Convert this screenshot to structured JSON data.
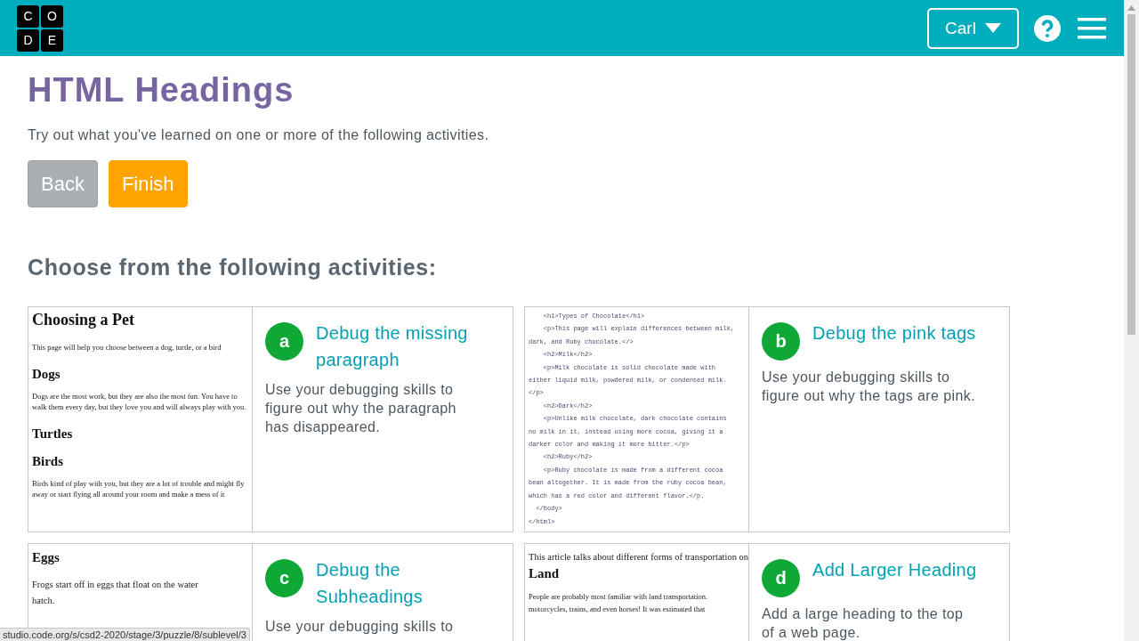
{
  "header": {
    "logo": [
      "C",
      "O",
      "D",
      "E"
    ],
    "user_button": "Carl"
  },
  "title": "HTML Headings",
  "intro": "Try out what you've learned on one or more of the following activities.",
  "buttons": [
    {
      "label": "Back",
      "disabled": true
    },
    {
      "label": "Finish",
      "disabled": false
    }
  ],
  "section_heading": "Choose from the following activities:",
  "activities": [
    {
      "letter": "a",
      "title": "Debug the missing paragraph",
      "description": "Use your debugging skills to figure out why the paragraph has disappeared.",
      "preview": [
        {
          "kind": "h1",
          "text": "Choosing a Pet"
        },
        {
          "kind": "p",
          "text": "This page will help you choose between a dog, turtle, or a bird"
        },
        {
          "kind": "h2",
          "text": "Dogs"
        },
        {
          "kind": "p",
          "text": "Dogs are the most work, but they are also the most fun. You have to walk them every day, but they love you and will always play with you."
        },
        {
          "kind": "h2",
          "text": "Turtles"
        },
        {
          "kind": "h2",
          "text": "Birds"
        },
        {
          "kind": "p",
          "text": "Birds kind of play with you, but they are a lot of trouble and might fly away or start flying all around your room and make a mess of it"
        }
      ]
    },
    {
      "letter": "b",
      "title": "Debug the pink tags",
      "description": "Use your debugging skills to figure out why the tags are pink.",
      "preview": [
        {
          "kind": "code",
          "text": "    <h1>Types of Chocolate</h1>"
        },
        {
          "kind": "code",
          "text": "    <p>This page will explain differences between milk,"
        },
        {
          "kind": "code",
          "text": "dark, and Ruby chocolate.</>"
        },
        {
          "kind": "code",
          "text": "    <h2>Milk</h2>"
        },
        {
          "kind": "code",
          "text": "    <p>Milk chocolate is solid chocolate made with"
        },
        {
          "kind": "code",
          "text": "either liquid milk, powdered milk, or condensed milk."
        },
        {
          "kind": "code",
          "text": "</p>"
        },
        {
          "kind": "code",
          "text": "    <h2>Dark</h2>"
        },
        {
          "kind": "code",
          "text": "    <p>Unlike milk chocolate, dark chocolate contains"
        },
        {
          "kind": "code",
          "text": "no milk in it, instead using more cocoa, giving it a"
        },
        {
          "kind": "code",
          "text": "darker color and making it more bitter.</p>"
        },
        {
          "kind": "code",
          "text": "    <h2>Ruby</h2>"
        },
        {
          "kind": "code",
          "text": "    <p>Ruby chocolate is made from a different cocoa"
        },
        {
          "kind": "code",
          "text": "bean altogether. It is made from the ruby cocoa bean,"
        },
        {
          "kind": "code",
          "text": "which has a red color and different flavor.</p."
        },
        {
          "kind": "code",
          "text": "  </body>"
        },
        {
          "kind": "code",
          "text": "</html>"
        }
      ]
    },
    {
      "letter": "c",
      "title": "Debug the Subheadings",
      "description": "Use your debugging skills to",
      "preview": [
        {
          "kind": "h2",
          "text": "Eggs"
        },
        {
          "kind": "p2",
          "text": "Frogs start off in eggs that float on the water"
        },
        {
          "kind": "p2",
          "text": "hatch."
        }
      ]
    },
    {
      "letter": "d",
      "title": "Add Larger Heading",
      "description": "Add a large heading to the top of a web page.",
      "preview": [
        {
          "kind": "p2",
          "text": "This article talks about different forms of transportation on"
        },
        {
          "kind": "h2",
          "text": "Land"
        },
        {
          "kind": "p3",
          "text": "People are probably most familiar with land transportation."
        },
        {
          "kind": "p3",
          "text": "motorcycles, trains, and even horses! It was estimated that"
        }
      ]
    }
  ],
  "status_bar": "studio.code.org/s/csd2-2020/stage/3/puzzle/8/sublevel/3"
}
